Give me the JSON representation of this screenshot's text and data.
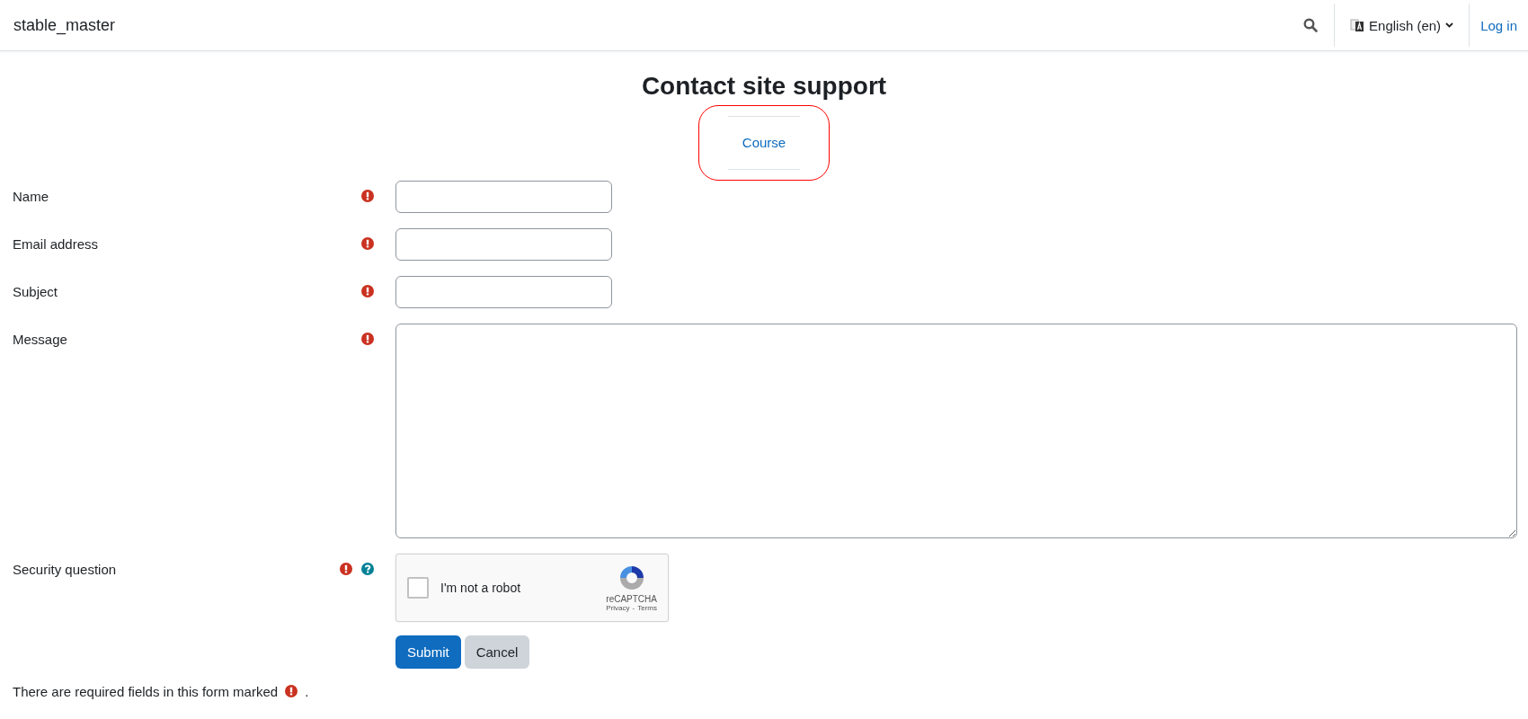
{
  "header": {
    "site_name": "stable_master",
    "language": "English (en)",
    "login": "Log in"
  },
  "title": "Contact site support",
  "course_link": "Course",
  "fields": [
    {
      "label": "Name",
      "kind": "text",
      "required": true,
      "help": false
    },
    {
      "label": "Email address",
      "kind": "text",
      "required": true,
      "help": false
    },
    {
      "label": "Subject",
      "kind": "text",
      "required": true,
      "help": false
    },
    {
      "label": "Message",
      "kind": "textarea",
      "required": true,
      "help": false
    },
    {
      "label": "Security question",
      "kind": "captcha",
      "required": true,
      "help": true,
      "captcha": {
        "checked": false,
        "text": "I'm not a robot",
        "brand": "reCAPTCHA",
        "privacy": "Privacy",
        "separator": "-",
        "terms": "Terms"
      }
    }
  ],
  "buttons": [
    {
      "label": "Submit",
      "kind": "primary"
    },
    {
      "label": "Cancel",
      "kind": "secondary"
    }
  ],
  "required_note": {
    "before": "There are required fields in this form marked",
    "after": "."
  }
}
